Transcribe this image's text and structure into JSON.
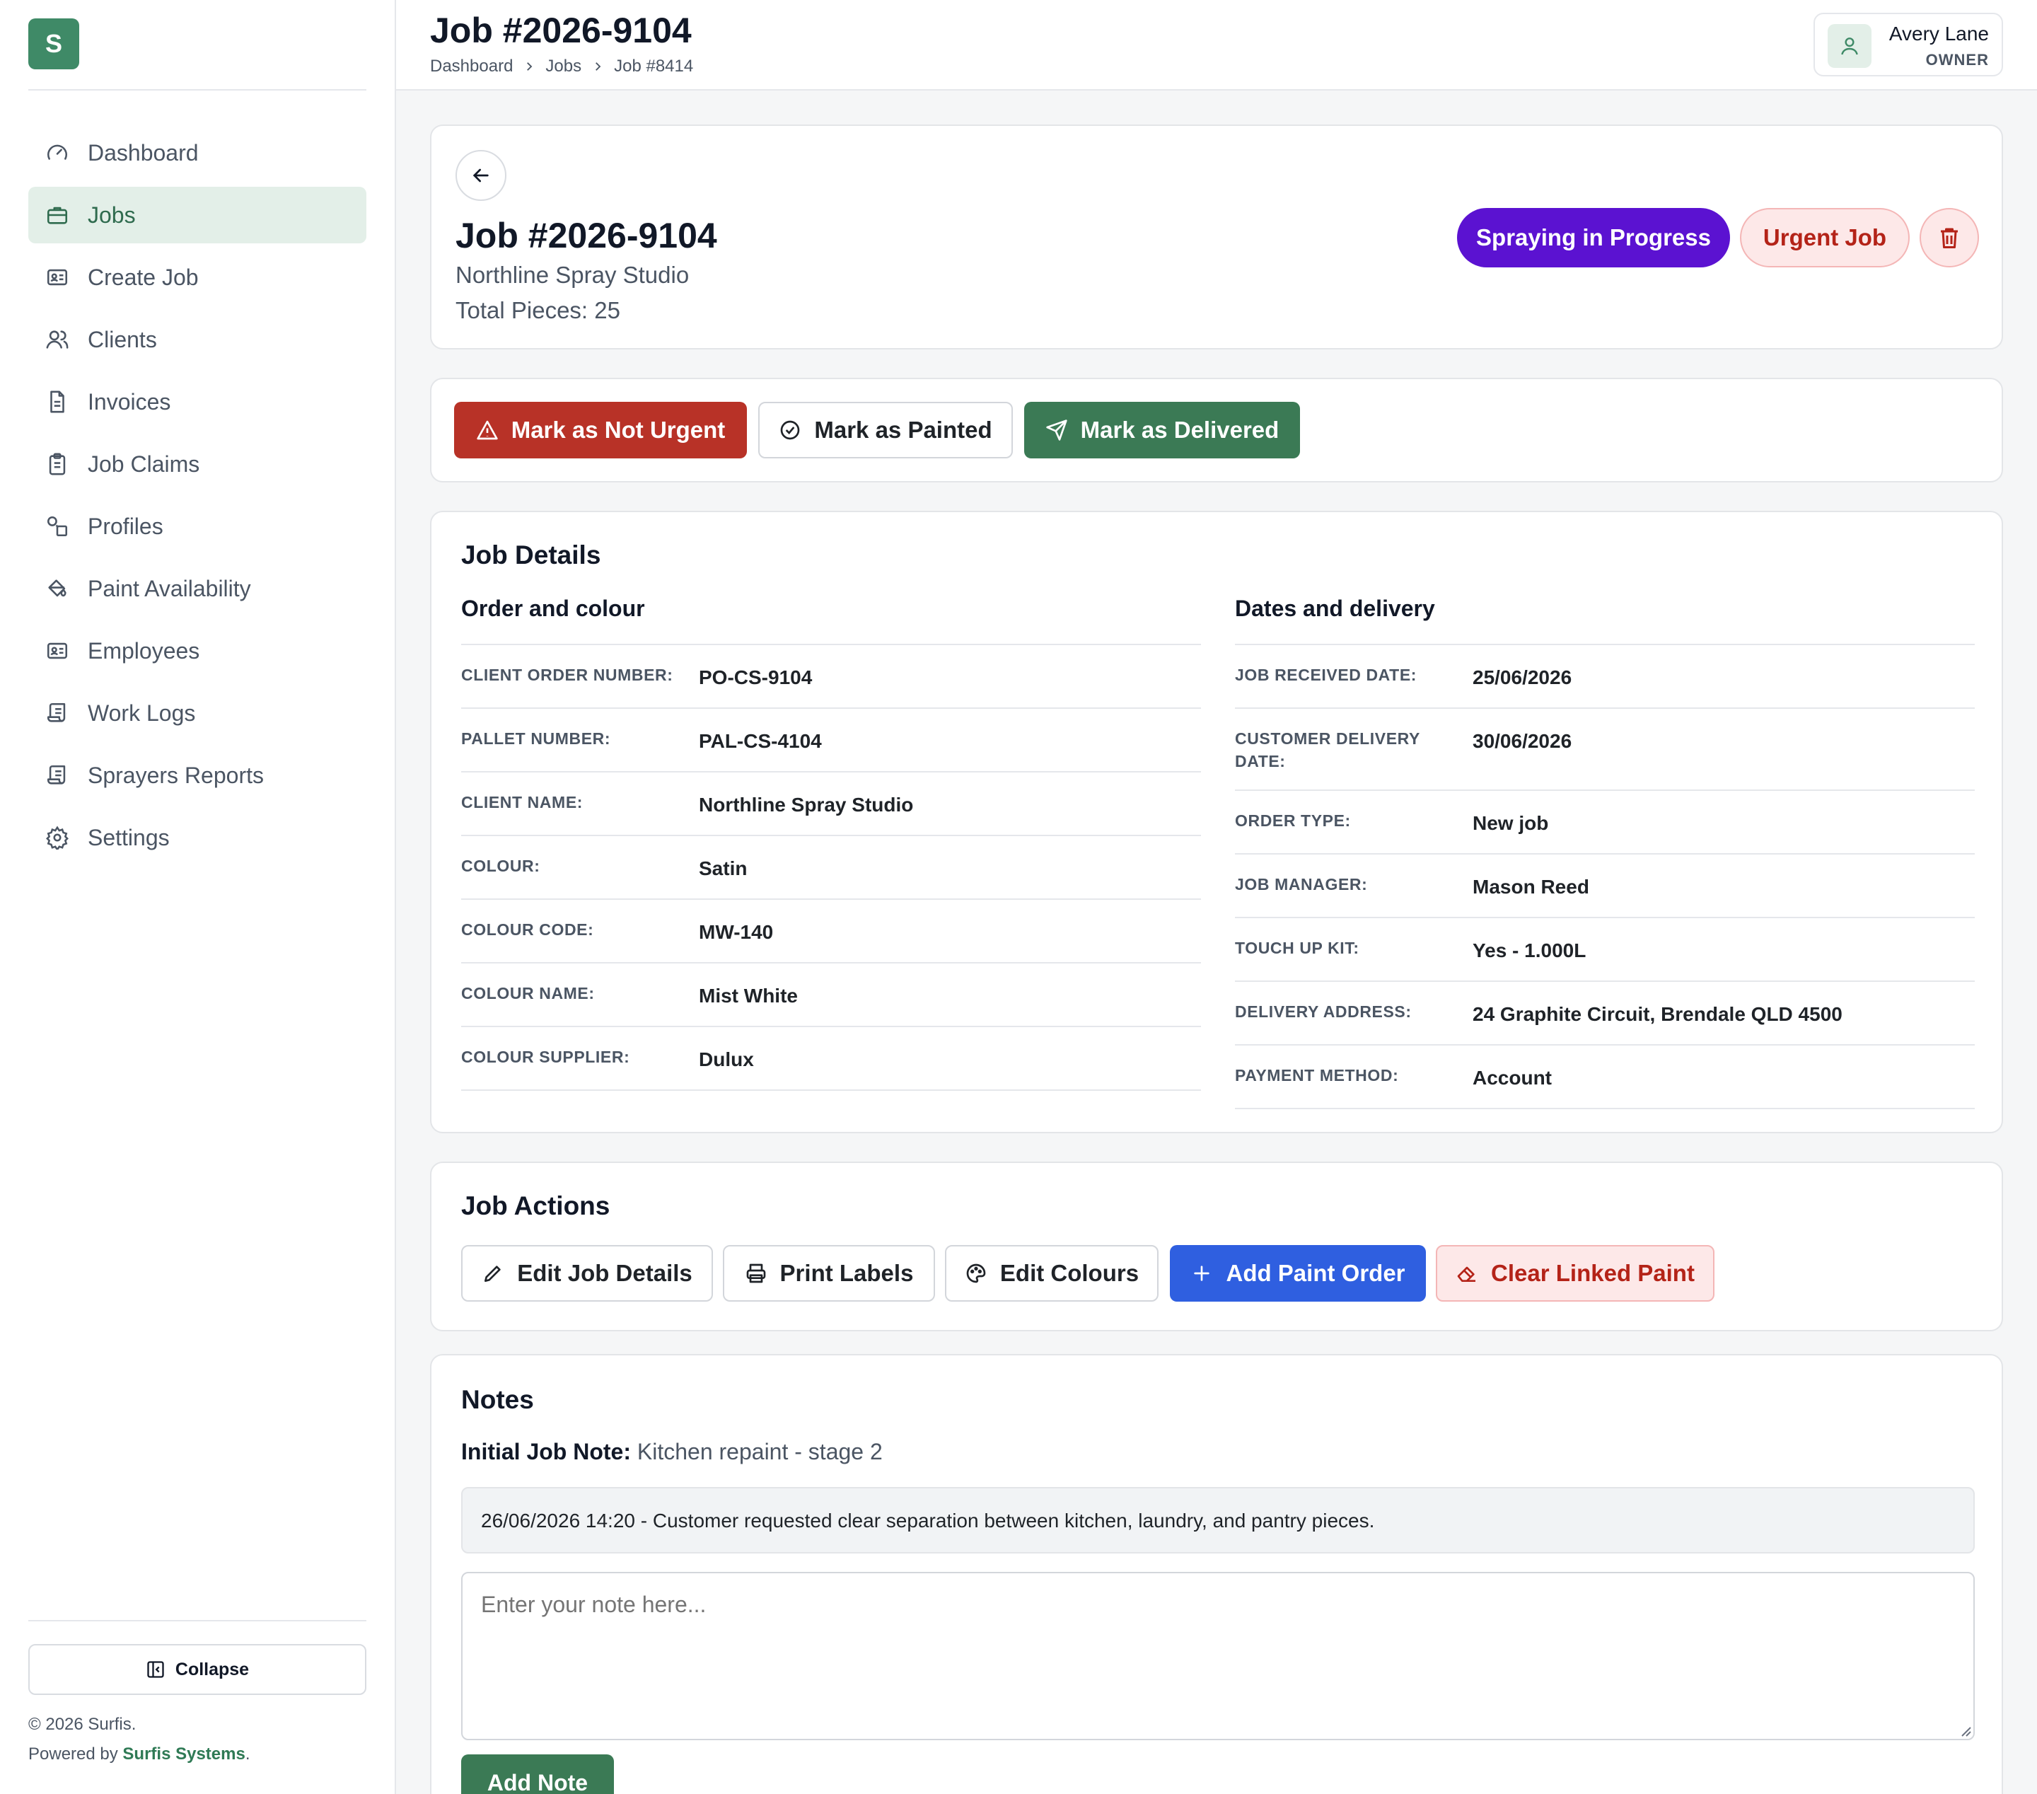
{
  "app": {
    "logo_letter": "S"
  },
  "sidebar": {
    "items": [
      {
        "label": "Dashboard",
        "icon": "gauge-icon"
      },
      {
        "label": "Jobs",
        "icon": "briefcase-icon",
        "active": true
      },
      {
        "label": "Create Job",
        "icon": "id-card-icon"
      },
      {
        "label": "Clients",
        "icon": "users-icon"
      },
      {
        "label": "Invoices",
        "icon": "file-text-icon"
      },
      {
        "label": "Job Claims",
        "icon": "clipboard-icon"
      },
      {
        "label": "Profiles",
        "icon": "shapes-icon"
      },
      {
        "label": "Paint Availability",
        "icon": "paint-bucket-icon"
      },
      {
        "label": "Employees",
        "icon": "id-card-icon"
      },
      {
        "label": "Work Logs",
        "icon": "scroll-icon"
      },
      {
        "label": "Sprayers Reports",
        "icon": "scroll-icon"
      },
      {
        "label": "Settings",
        "icon": "gear-icon"
      }
    ],
    "collapse_label": "Collapse",
    "copyright": "© 2026 Surfis.",
    "powered_prefix": "Powered by",
    "powered_link": "Surfis Systems",
    "powered_suffix": "."
  },
  "header": {
    "title": "Job #2026-9104",
    "breadcrumb": [
      "Dashboard",
      "Jobs",
      "Job #8414"
    ],
    "user_name": "Avery Lane",
    "user_role": "OWNER"
  },
  "job": {
    "title": "Job #2026-9104",
    "client": "Northline Spray Studio",
    "total_pieces": "Total Pieces: 25",
    "status_label": "Spraying in Progress",
    "urgent_label": "Urgent Job"
  },
  "quick_actions": {
    "not_urgent": "Mark as Not Urgent",
    "painted": "Mark as Painted",
    "delivered": "Mark as Delivered"
  },
  "details": {
    "title": "Job Details",
    "left_title": "Order and colour",
    "right_title": "Dates and delivery",
    "left": [
      {
        "key": "CLIENT ORDER NUMBER:",
        "value": "PO-CS-9104"
      },
      {
        "key": "PALLET NUMBER:",
        "value": "PAL-CS-4104"
      },
      {
        "key": "CLIENT NAME:",
        "value": "Northline Spray Studio"
      },
      {
        "key": "COLOUR:",
        "value": "Satin"
      },
      {
        "key": "COLOUR CODE:",
        "value": "MW-140"
      },
      {
        "key": "COLOUR NAME:",
        "value": "Mist White"
      },
      {
        "key": "COLOUR SUPPLIER:",
        "value": "Dulux"
      }
    ],
    "right": [
      {
        "key": "JOB RECEIVED DATE:",
        "value": "25/06/2026"
      },
      {
        "key": "CUSTOMER DELIVERY DATE:",
        "value": "30/06/2026"
      },
      {
        "key": "ORDER TYPE:",
        "value": "New job"
      },
      {
        "key": "JOB MANAGER:",
        "value": "Mason Reed"
      },
      {
        "key": "TOUCH UP KIT:",
        "value": "Yes - 1.000L"
      },
      {
        "key": "DELIVERY ADDRESS:",
        "value": "24 Graphite Circuit, Brendale QLD 4500"
      },
      {
        "key": "PAYMENT METHOD:",
        "value": "Account"
      }
    ]
  },
  "job_actions": {
    "title": "Job Actions",
    "edit_details": "Edit Job Details",
    "print_labels": "Print Labels",
    "edit_colours": "Edit Colours",
    "add_paint_order": "Add Paint Order",
    "clear_linked_paint": "Clear Linked Paint"
  },
  "notes": {
    "title": "Notes",
    "initial_label": "Initial Job Note:",
    "initial_value": "Kitchen repaint - stage 2",
    "entries": [
      "26/06/2026 14:20 - Customer requested clear separation between kitchen, laundry, and pantry pieces."
    ],
    "placeholder": "Enter your note here...",
    "add_label": "Add Note"
  },
  "colors": {
    "brand": "#3f8a67",
    "status": "#5b12d1",
    "danger": "#b83227",
    "success": "#3b7a55",
    "primary": "#2f5fe0"
  }
}
